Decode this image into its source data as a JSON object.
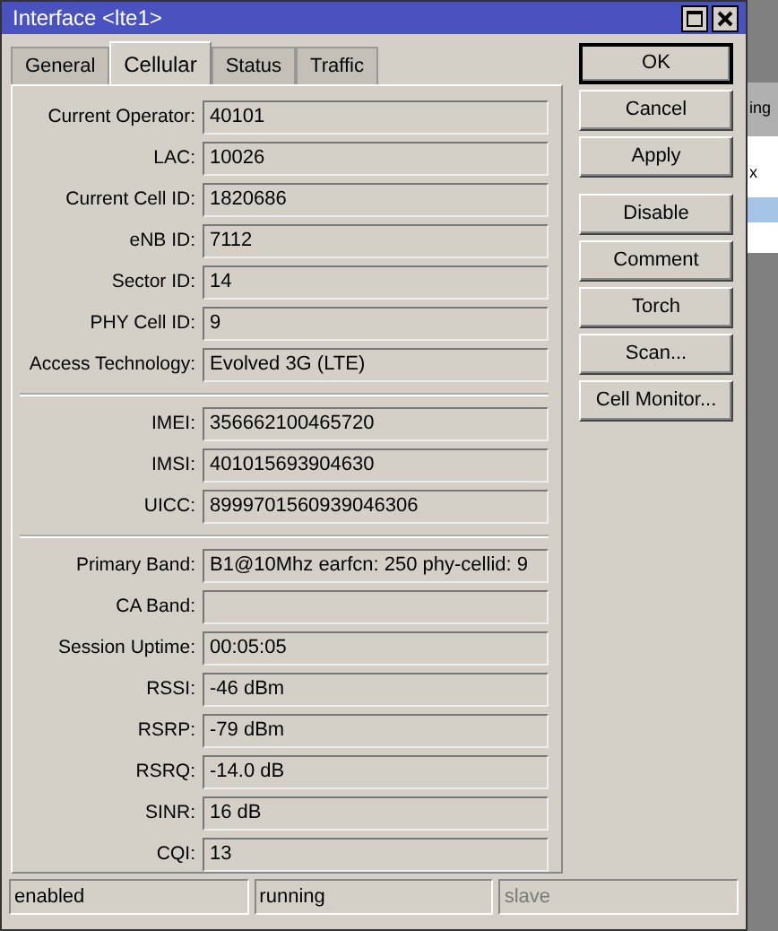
{
  "window": {
    "title": "Interface <lte1>"
  },
  "tabs": [
    {
      "label": "General",
      "selected": false
    },
    {
      "label": "Cellular",
      "selected": true
    },
    {
      "label": "Status",
      "selected": false
    },
    {
      "label": "Traffic",
      "selected": false
    }
  ],
  "sections": [
    {
      "fields": [
        {
          "label": "Current Operator:",
          "value": "40101"
        },
        {
          "label": "LAC:",
          "value": "10026"
        },
        {
          "label": "Current Cell ID:",
          "value": "1820686"
        },
        {
          "label": "eNB ID:",
          "value": "7112"
        },
        {
          "label": "Sector ID:",
          "value": "14"
        },
        {
          "label": "PHY Cell ID:",
          "value": "9"
        },
        {
          "label": "Access Technology:",
          "value": "Evolved 3G (LTE)"
        }
      ]
    },
    {
      "fields": [
        {
          "label": "IMEI:",
          "value": "356662100465720"
        },
        {
          "label": "IMSI:",
          "value": "401015693904630"
        },
        {
          "label": "UICC:",
          "value": "8999701560939046306"
        }
      ]
    },
    {
      "fields": [
        {
          "label": "Primary Band:",
          "value": "B1@10Mhz earfcn: 250 phy-cellid: 9"
        },
        {
          "label": "CA Band:"
        },
        {
          "label": "Session Uptime:",
          "value": "00:05:05"
        },
        {
          "label": "RSSI:",
          "value": "-46 dBm"
        },
        {
          "label": "RSRP:",
          "value": "-79 dBm"
        },
        {
          "label": "RSRQ:",
          "value": "-14.0 dB"
        },
        {
          "label": "SINR:",
          "value": "16 dB"
        },
        {
          "label": "CQI:",
          "value": "13"
        }
      ]
    }
  ],
  "button_groups": [
    [
      "OK",
      "Cancel",
      "Apply"
    ],
    [
      "Disable",
      "Comment",
      "Torch",
      "Scan...",
      "Cell Monitor..."
    ]
  ],
  "status_bar": [
    {
      "text": "enabled",
      "disabled": false
    },
    {
      "text": "running",
      "disabled": false
    },
    {
      "text": "slave",
      "disabled": true
    }
  ],
  "background_window": {
    "texts": [
      "ing",
      "x"
    ]
  }
}
